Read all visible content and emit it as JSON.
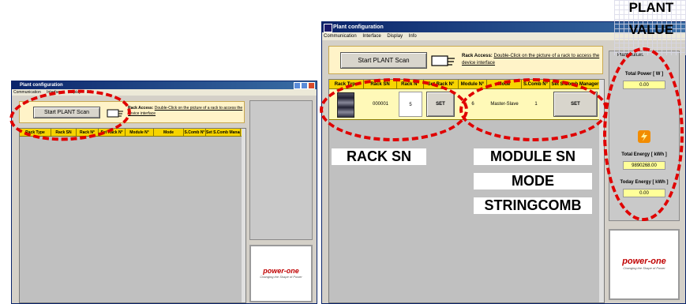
{
  "left_window": {
    "title": "Plant configuration",
    "menu": [
      "Communication",
      "Interface",
      "Display",
      "Info"
    ],
    "scan_button": "Start PLANT Scan",
    "rack_access_label": "Rack Access:",
    "rack_access_hint": "Double-Click on the picture of a rack to access the device interface",
    "columns": [
      "Rack Type",
      "Rack SN",
      "Rack N°",
      "Set Rack N°",
      "Module N°",
      "Mode",
      "S.Comb N°",
      "Set S.Comb Manager"
    ],
    "logo": "power-one",
    "logo_tagline": "Changing the Shape of Power"
  },
  "right_window": {
    "title": "Plant configuration",
    "menu": [
      "Communication",
      "Interface",
      "Display",
      "Info"
    ],
    "scan_button": "Start PLANT Scan",
    "rack_access_label": "Rack Access:",
    "rack_access_hint": "Double-Click on the picture of a rack to access the device interface",
    "columns": [
      "Rack Type",
      "Rack SN",
      "Rack N°",
      "Set Rack N°",
      "Module N°",
      "Mode",
      "S.Comb N°",
      "Set S.Comb Manager"
    ],
    "row": {
      "rack_sn": "000001",
      "rack_n": "5",
      "set_rack": "SET",
      "module_n": "6",
      "mode": "Master-Slave",
      "scomb_n": "1",
      "set_scomb": "SET"
    },
    "plant_values": {
      "title": "Plant Values",
      "total_power_label": "Total Power [ W ]",
      "total_power": "0.00",
      "total_energy_label": "Total Energy [ kWh ]",
      "total_energy": "9890268.00",
      "today_energy_label": "Today Energy [ kWh ]",
      "today_energy": "0.00"
    },
    "logo": "power-one",
    "logo_tagline": "Changing the Shape of Power"
  },
  "annotations": {
    "plant_value_line1": "PLANT",
    "plant_value_line2": "VALUE",
    "rack_sn": "RACK SN",
    "module_line1": "MODULE SN",
    "module_line2": "MODE",
    "module_line3": "STRINGCOMB"
  },
  "colors": {
    "titlebar": "#0a246a",
    "header_yellow": "#f7d400",
    "annotation_red": "#e00000"
  }
}
